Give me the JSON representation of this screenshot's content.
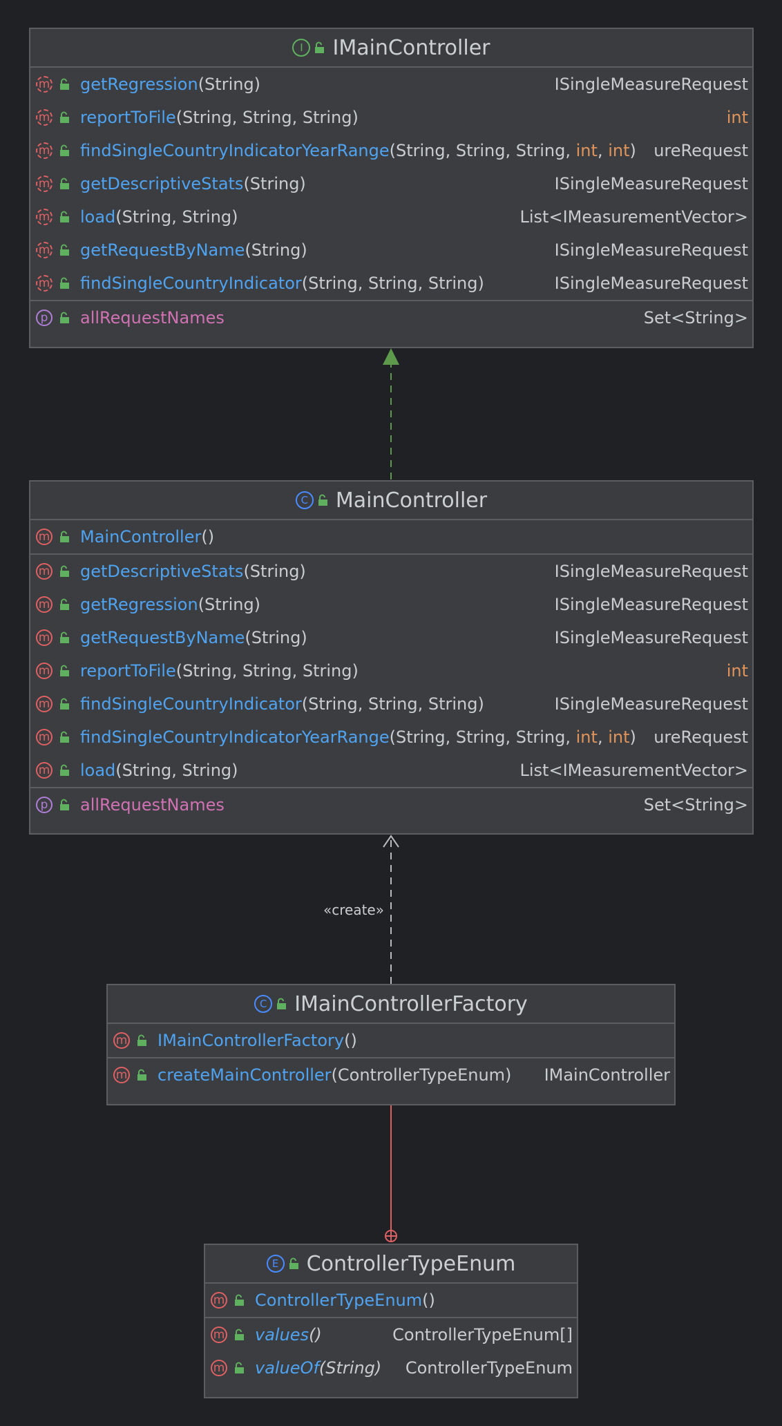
{
  "colors": {
    "background": "#202124",
    "method_name": "#4fa3f0",
    "property_name": "#d072b3",
    "primitive_type": "#e0945c",
    "text": "#c9ccd0",
    "realization_edge": "#5e9a4c",
    "dependency_edge": "#b9bbbe",
    "nested_edge": "#e06163"
  },
  "edges": {
    "create_label": "«create»"
  },
  "classes": [
    {
      "id": "imaincontroller",
      "kind": "interface",
      "kind_letter": "I",
      "name": "IMainController",
      "sections": [
        [
          {
            "badge": "m",
            "abstract": true,
            "name": "getRegression",
            "params": [
              {
                "t": "(String)"
              }
            ],
            "ret": "ISingleMeasureRequest"
          },
          {
            "badge": "m",
            "abstract": true,
            "name": "reportToFile",
            "params": [
              {
                "t": "(String, String, String)"
              }
            ],
            "ret": "int",
            "ret_prim": true
          },
          {
            "badge": "m",
            "abstract": true,
            "name": "findSingleCountryIndicatorYearRange",
            "params": [
              {
                "t": "(String, String, String, "
              },
              {
                "t": "int",
                "p": true
              },
              {
                "t": ", "
              },
              {
                "t": "int",
                "p": true
              },
              {
                "t": ")"
              }
            ],
            "ret": "ureRequest"
          },
          {
            "badge": "m",
            "abstract": true,
            "name": "getDescriptiveStats",
            "params": [
              {
                "t": "(String)"
              }
            ],
            "ret": "ISingleMeasureRequest"
          },
          {
            "badge": "m",
            "abstract": true,
            "name": "load",
            "params": [
              {
                "t": "(String, String)"
              }
            ],
            "ret": "List<IMeasurementVector>"
          },
          {
            "badge": "m",
            "abstract": true,
            "name": "getRequestByName",
            "params": [
              {
                "t": "(String)"
              }
            ],
            "ret": "ISingleMeasureRequest"
          },
          {
            "badge": "m",
            "abstract": true,
            "name": "findSingleCountryIndicator",
            "params": [
              {
                "t": "(String, String, String)"
              }
            ],
            "ret": "ISingleMeasureRequest"
          }
        ],
        [
          {
            "badge": "p",
            "name": "allRequestNames",
            "ret": "Set<String>"
          }
        ]
      ]
    },
    {
      "id": "maincontroller",
      "kind": "class",
      "kind_letter": "C",
      "name": "MainController",
      "sections": [
        [
          {
            "badge": "m",
            "name": "MainController",
            "params": [
              {
                "t": "()"
              }
            ],
            "ret": ""
          }
        ],
        [
          {
            "badge": "m",
            "name": "getDescriptiveStats",
            "params": [
              {
                "t": "(String)"
              }
            ],
            "ret": "ISingleMeasureRequest"
          },
          {
            "badge": "m",
            "name": "getRegression",
            "params": [
              {
                "t": "(String)"
              }
            ],
            "ret": "ISingleMeasureRequest"
          },
          {
            "badge": "m",
            "name": "getRequestByName",
            "params": [
              {
                "t": "(String)"
              }
            ],
            "ret": "ISingleMeasureRequest"
          },
          {
            "badge": "m",
            "name": "reportToFile",
            "params": [
              {
                "t": "(String, String, String)"
              }
            ],
            "ret": "int",
            "ret_prim": true
          },
          {
            "badge": "m",
            "name": "findSingleCountryIndicator",
            "params": [
              {
                "t": "(String, String, String)"
              }
            ],
            "ret": "ISingleMeasureRequest"
          },
          {
            "badge": "m",
            "name": "findSingleCountryIndicatorYearRange",
            "params": [
              {
                "t": "(String, String, String, "
              },
              {
                "t": "int",
                "p": true
              },
              {
                "t": ", "
              },
              {
                "t": "int",
                "p": true
              },
              {
                "t": ")"
              }
            ],
            "ret": "ureRequest"
          },
          {
            "badge": "m",
            "name": "load",
            "params": [
              {
                "t": "(String, String)"
              }
            ],
            "ret": "List<IMeasurementVector>"
          }
        ],
        [
          {
            "badge": "p",
            "name": "allRequestNames",
            "ret": "Set<String>"
          }
        ]
      ]
    },
    {
      "id": "imaincontrollerfactory",
      "kind": "class",
      "kind_letter": "C",
      "name": "IMainControllerFactory",
      "sections": [
        [
          {
            "badge": "m",
            "name": "IMainControllerFactory",
            "params": [
              {
                "t": "()"
              }
            ],
            "ret": ""
          }
        ],
        [
          {
            "badge": "m",
            "name": "createMainController",
            "params": [
              {
                "t": "(ControllerTypeEnum)"
              }
            ],
            "ret": "IMainController"
          }
        ]
      ]
    },
    {
      "id": "controllertypeenum",
      "kind": "enum",
      "kind_letter": "E",
      "name": "ControllerTypeEnum",
      "sections": [
        [
          {
            "badge": "m",
            "name": "ControllerTypeEnum",
            "params": [
              {
                "t": "()"
              }
            ],
            "ret": ""
          }
        ],
        [
          {
            "badge": "m",
            "italic": true,
            "name": "values",
            "params": [
              {
                "t": "()"
              }
            ],
            "ret": "ControllerTypeEnum[]"
          },
          {
            "badge": "m",
            "italic": true,
            "name": "valueOf",
            "params": [
              {
                "t": "(String)"
              }
            ],
            "ret": "ControllerTypeEnum"
          }
        ]
      ]
    }
  ]
}
